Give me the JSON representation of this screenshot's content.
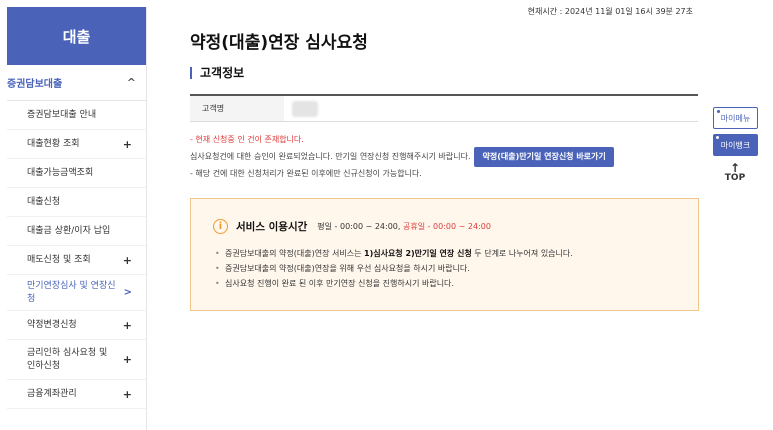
{
  "sidebar": {
    "header": "대출",
    "section": {
      "label": "증권담보대출",
      "chevron": "^"
    },
    "items": [
      {
        "label": "증권담보대출 안내",
        "mark": ""
      },
      {
        "label": "대출현황 조회",
        "mark": "+"
      },
      {
        "label": "대출가능금액조회",
        "mark": ""
      },
      {
        "label": "대출신청",
        "mark": ""
      },
      {
        "label": "대출금 상환/이자 납입",
        "mark": ""
      },
      {
        "label": "매도신청 및 조회",
        "mark": "+"
      },
      {
        "label": "만기연장심사 및 연장신청",
        "mark": ">"
      },
      {
        "label": "약정변경신청",
        "mark": "+"
      },
      {
        "label": "금리인하 심사요청 및 인하신청",
        "mark": "+"
      },
      {
        "label": "금융계좌관리",
        "mark": "+"
      }
    ]
  },
  "timestamp": "현재시간 : 2024년 11월 01일 16시 39분 27초",
  "page_title": "약정(대출)연장 심사요청",
  "customer_section": {
    "title": "고객정보",
    "name_label": "고객명"
  },
  "notice": {
    "line1": "- 현재 신청중 인 건이 존재합니다.",
    "line2": "심사요청건에 대한 승인이 완료되었습니다. 만기일 연장신청 진행해주시기 바랍니다.",
    "shortcut_button": "약정(대출)만기일 연장신청 바로가기",
    "line3": "- 해당 건에 대한 신청처리가 완료된 이후에만 신규신청이 가능합니다."
  },
  "service": {
    "title": "서비스 이용시간",
    "weekday": "평일 - 00:00 ~ 24:00,",
    "holiday": "공휴일 - 00:00 ~ 24:00",
    "bullet1_pre": "증권담보대출의 약정(대출)연장 서비스는 ",
    "bullet1_bold": "1)심사요청 2)만기일 연장 신청",
    "bullet1_post": " 두 단계로 나누어져 있습니다.",
    "bullet2": "증권담보대출의 약정(대출)연장을 위해 우선 심사요청을 하시기 바랍니다.",
    "bullet3": "심사요청 진행이 완료 된 이후 만기연장 신청을 진행하시기 바랍니다."
  },
  "floating": {
    "my_menu": "마이메뉴",
    "my_bank": "마이뱅크",
    "top": "TOP",
    "top_arrow": "↑"
  },
  "colors": {
    "brand": "#4a63b8",
    "alert": "#e03a3a",
    "info_icon": "#f19a2a",
    "service_bg": "#fff7ec"
  }
}
